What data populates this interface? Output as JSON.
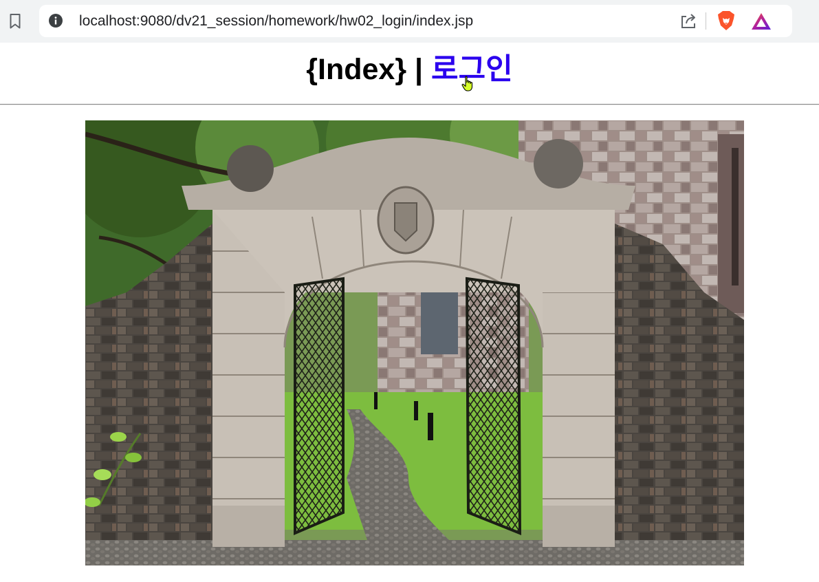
{
  "browser": {
    "url": "localhost:9080/dv21_session/homework/hw02_login/index.jsp",
    "icons": {
      "bookmark": "bookmark-icon",
      "site_info": "info-icon",
      "share": "share-icon",
      "brave_shields": "brave-lion-icon",
      "brave_rewards": "rewards-triangle-icon"
    }
  },
  "page": {
    "title_text": "{Index}",
    "separator": " | ",
    "login_link": "로그인",
    "link_color": "#2b00ee",
    "image_subject": "stone-archway-with-open-iron-gates-photo"
  }
}
